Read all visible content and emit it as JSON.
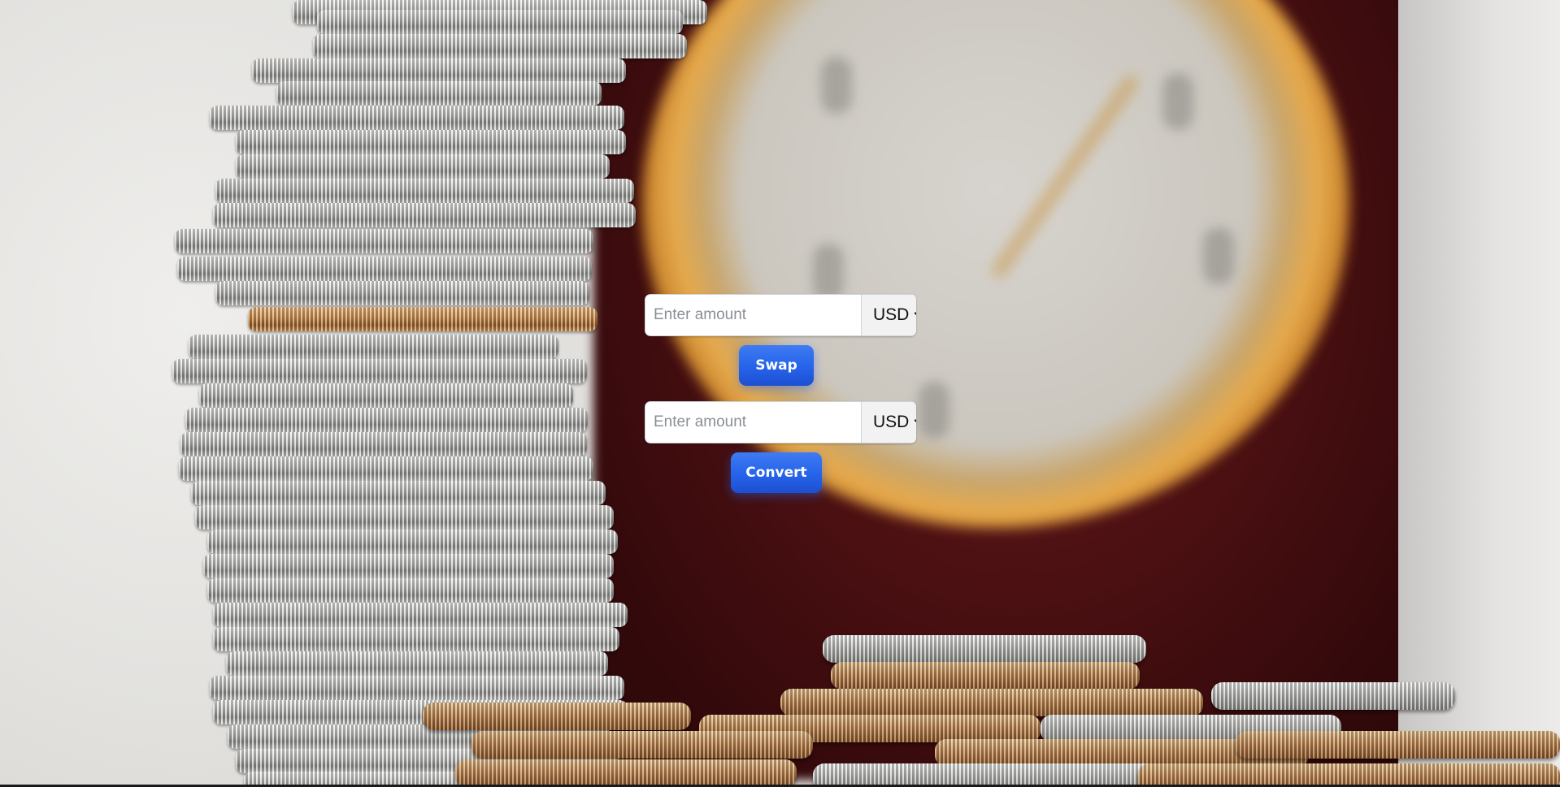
{
  "converter": {
    "from": {
      "amount_placeholder": "Enter amount",
      "amount_value": "",
      "currency_selected": "USD"
    },
    "swap_label": "Swap",
    "to": {
      "amount_placeholder": "Enter amount",
      "amount_value": "",
      "currency_selected": "USD"
    },
    "convert_label": "Convert"
  },
  "background": {
    "description_icon": "coins-and-clock-photo",
    "accent_color": "#2563eb"
  }
}
